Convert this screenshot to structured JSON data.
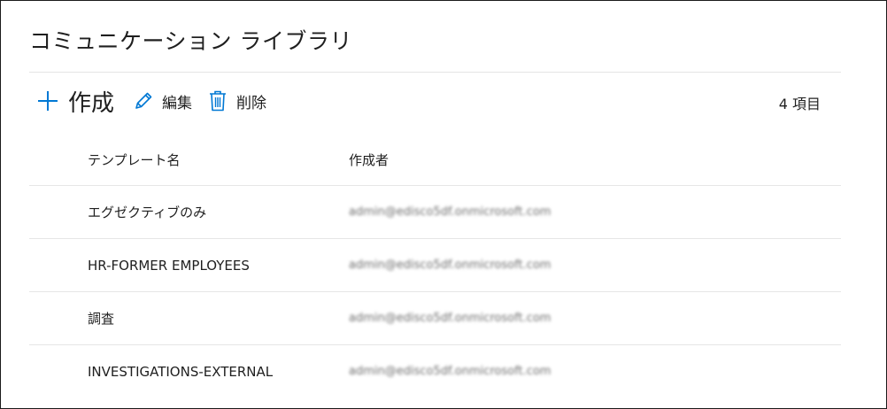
{
  "page": {
    "title": "コミュニケーション ライブラリ"
  },
  "toolbar": {
    "create_label": "作成",
    "edit_label": "編集",
    "delete_label": "削除",
    "item_count": "4 項目",
    "icons": [
      "plus-icon",
      "pencil-icon",
      "trash-icon"
    ],
    "accent_color": "#0078d4"
  },
  "table": {
    "columns": [
      "テンプレート名",
      "作成者"
    ],
    "rows": [
      {
        "name": "エグゼクティブのみ",
        "creator": "admin@edisco5df.onmicrosoft.com"
      },
      {
        "name": "HR-FORMER EMPLOYEES",
        "creator": "admin@edisco5df.onmicrosoft.com"
      },
      {
        "name": "調査",
        "creator": "admin@edisco5df.onmicrosoft.com"
      },
      {
        "name": "INVESTIGATIONS-EXTERNAL",
        "creator": "admin@edisco5df.onmicrosoft.com"
      }
    ]
  }
}
